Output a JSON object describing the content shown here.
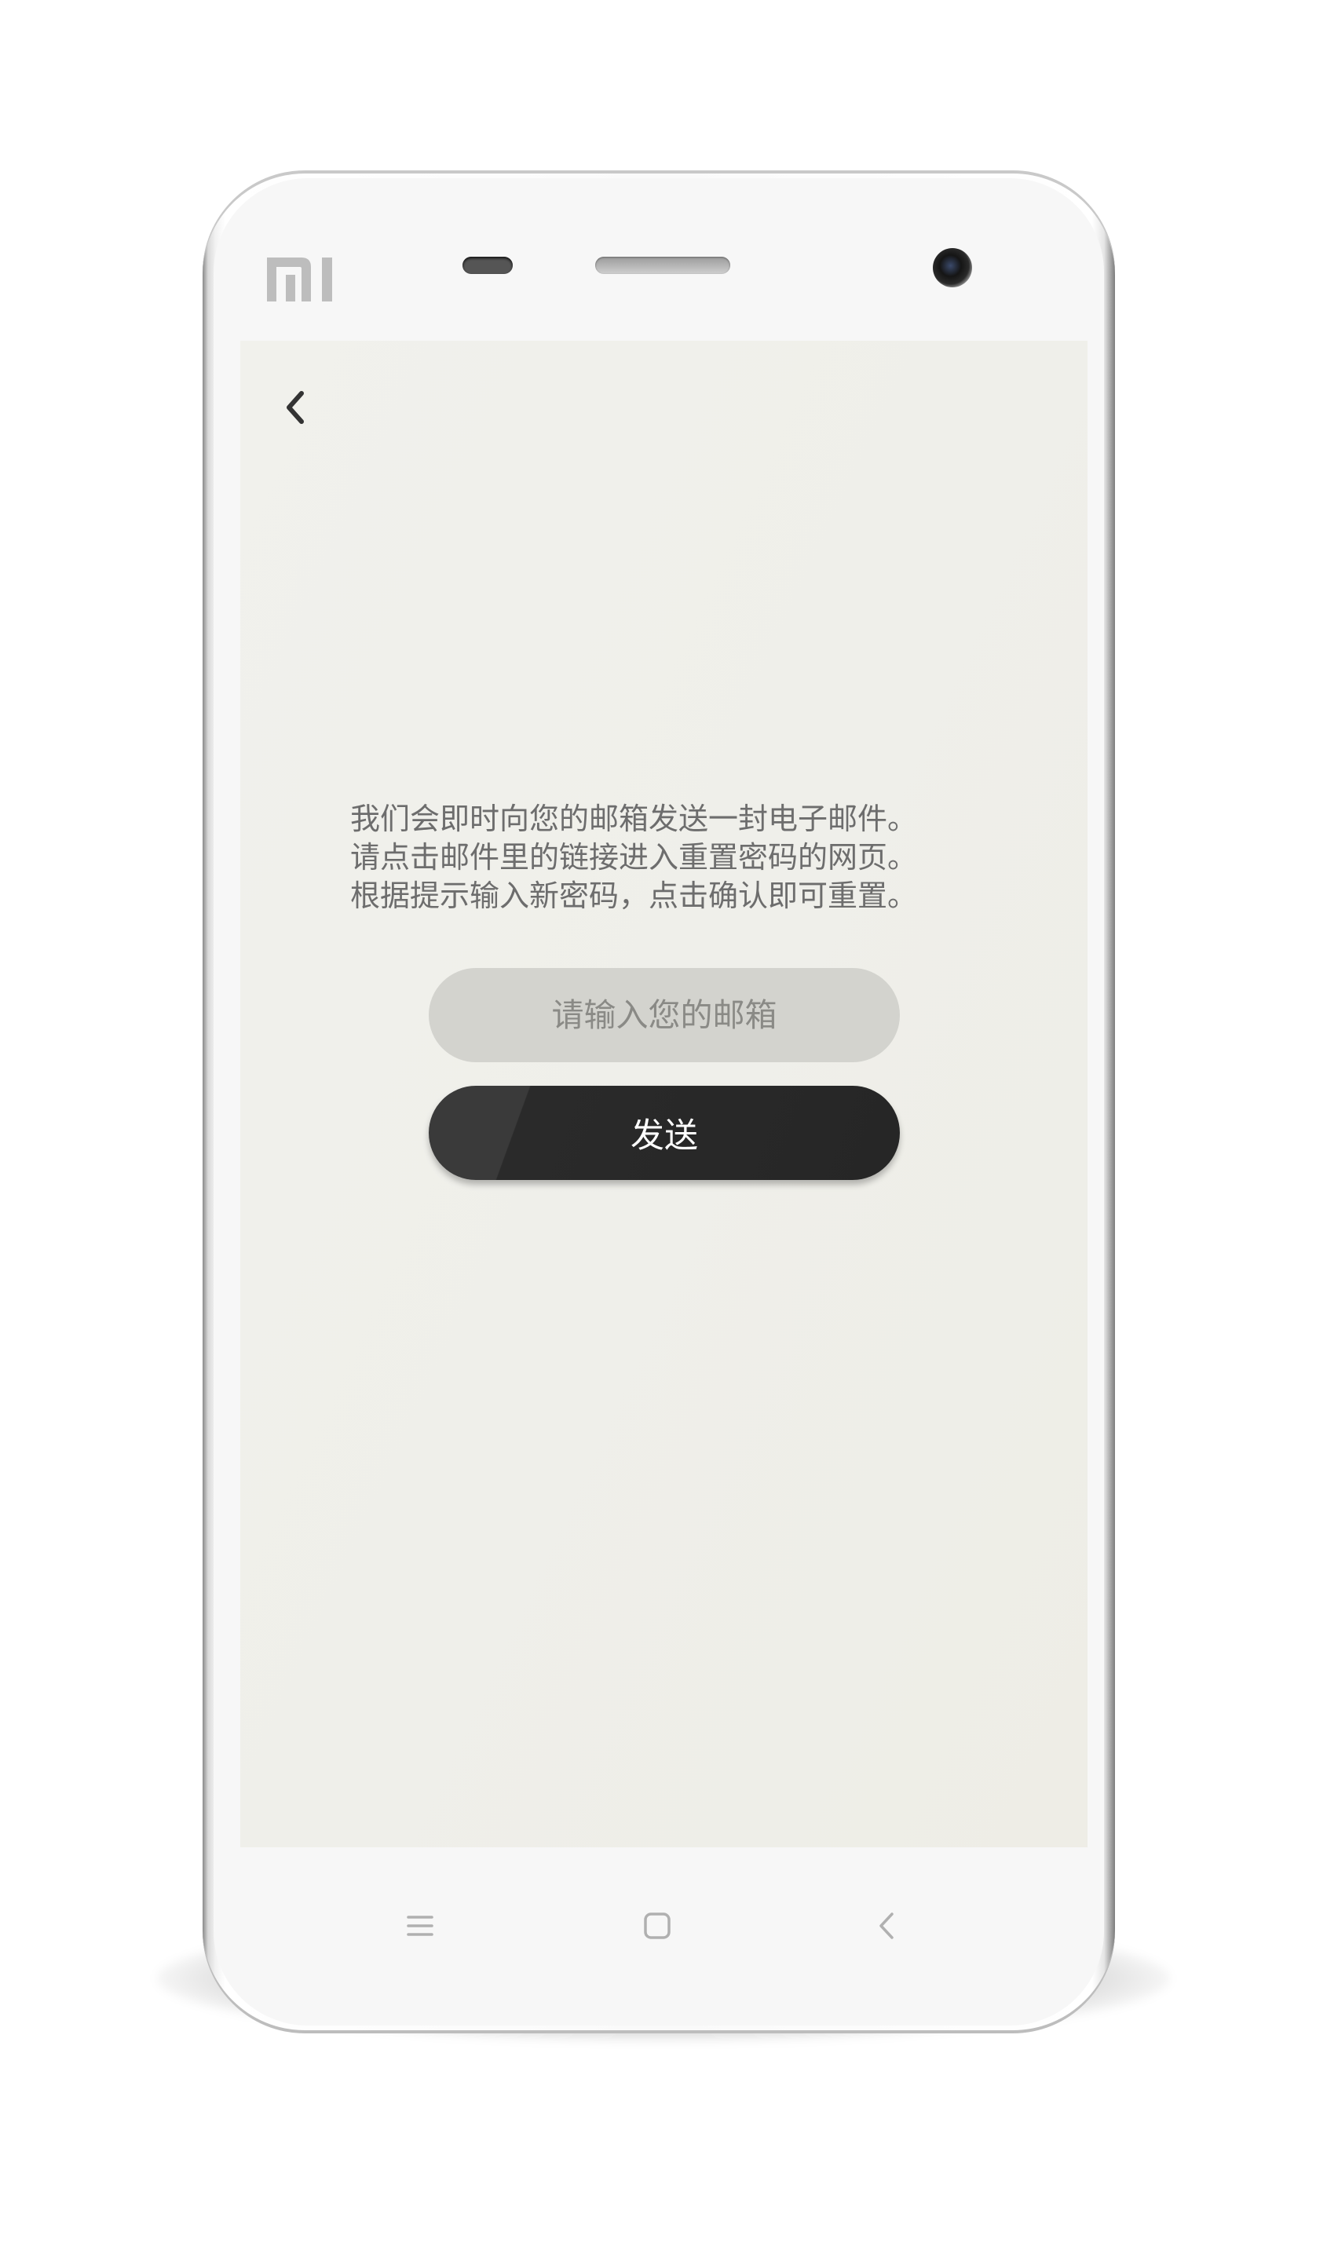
{
  "screen": {
    "back_icon": "chevron-left-icon",
    "description_lines": [
      "我们会即时向您的邮箱发送一封电子邮件。",
      "请点击邮件里的链接进入重置密码的网页。",
      "根据提示输入新密码，点击确认即可重置。"
    ],
    "email_input": {
      "placeholder": "请输入您的邮箱",
      "value": ""
    },
    "send_button_label": "发送"
  },
  "device": {
    "brand_logo": "MI",
    "nav_buttons": [
      "menu-icon",
      "home-icon",
      "back-icon"
    ]
  },
  "colors": {
    "screen_background": "#efefea",
    "input_background": "#d3d3ce",
    "button_background": "#2b2b2b",
    "text": "#6d6d6d"
  }
}
